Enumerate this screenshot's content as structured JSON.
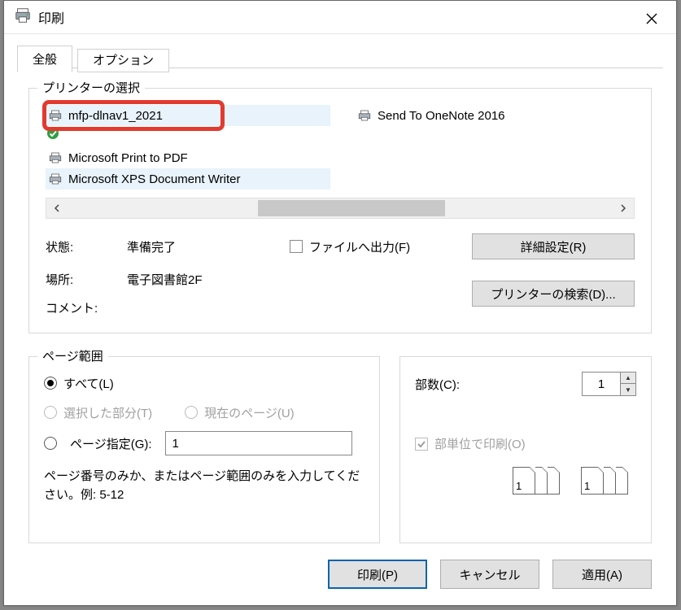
{
  "title": "印刷",
  "tabs": {
    "general": "全般",
    "options": "オプション"
  },
  "printerSelect": {
    "title": "プリンターの選択",
    "items": [
      "mfp-dlnav1_2021",
      "Microsoft Print to PDF",
      "Microsoft XPS Document Writer",
      "Send To OneNote 2016"
    ],
    "status": {
      "label": "状態:",
      "value": "準備完了"
    },
    "location": {
      "label": "場所:",
      "value": "電子図書館2F"
    },
    "comment": {
      "label": "コメント:",
      "value": ""
    },
    "outputToFile": "ファイルへ出力(F)",
    "details": "詳細設定(R)",
    "findPrinter": "プリンターの検索(D)..."
  },
  "pageRange": {
    "title": "ページ範囲",
    "all": "すべて(L)",
    "selection": "選択した部分(T)",
    "current": "現在のページ(U)",
    "pages": "ページ指定(G):",
    "pagesValue": "1",
    "hint": "ページ番号のみか、またはページ範囲のみを入力してください。例: 5-12"
  },
  "copies": {
    "label": "部数(C):",
    "value": "1",
    "collate": "部単位で印刷(O)"
  },
  "footer": {
    "print": "印刷(P)",
    "cancel": "キャンセル",
    "apply": "適用(A)"
  }
}
